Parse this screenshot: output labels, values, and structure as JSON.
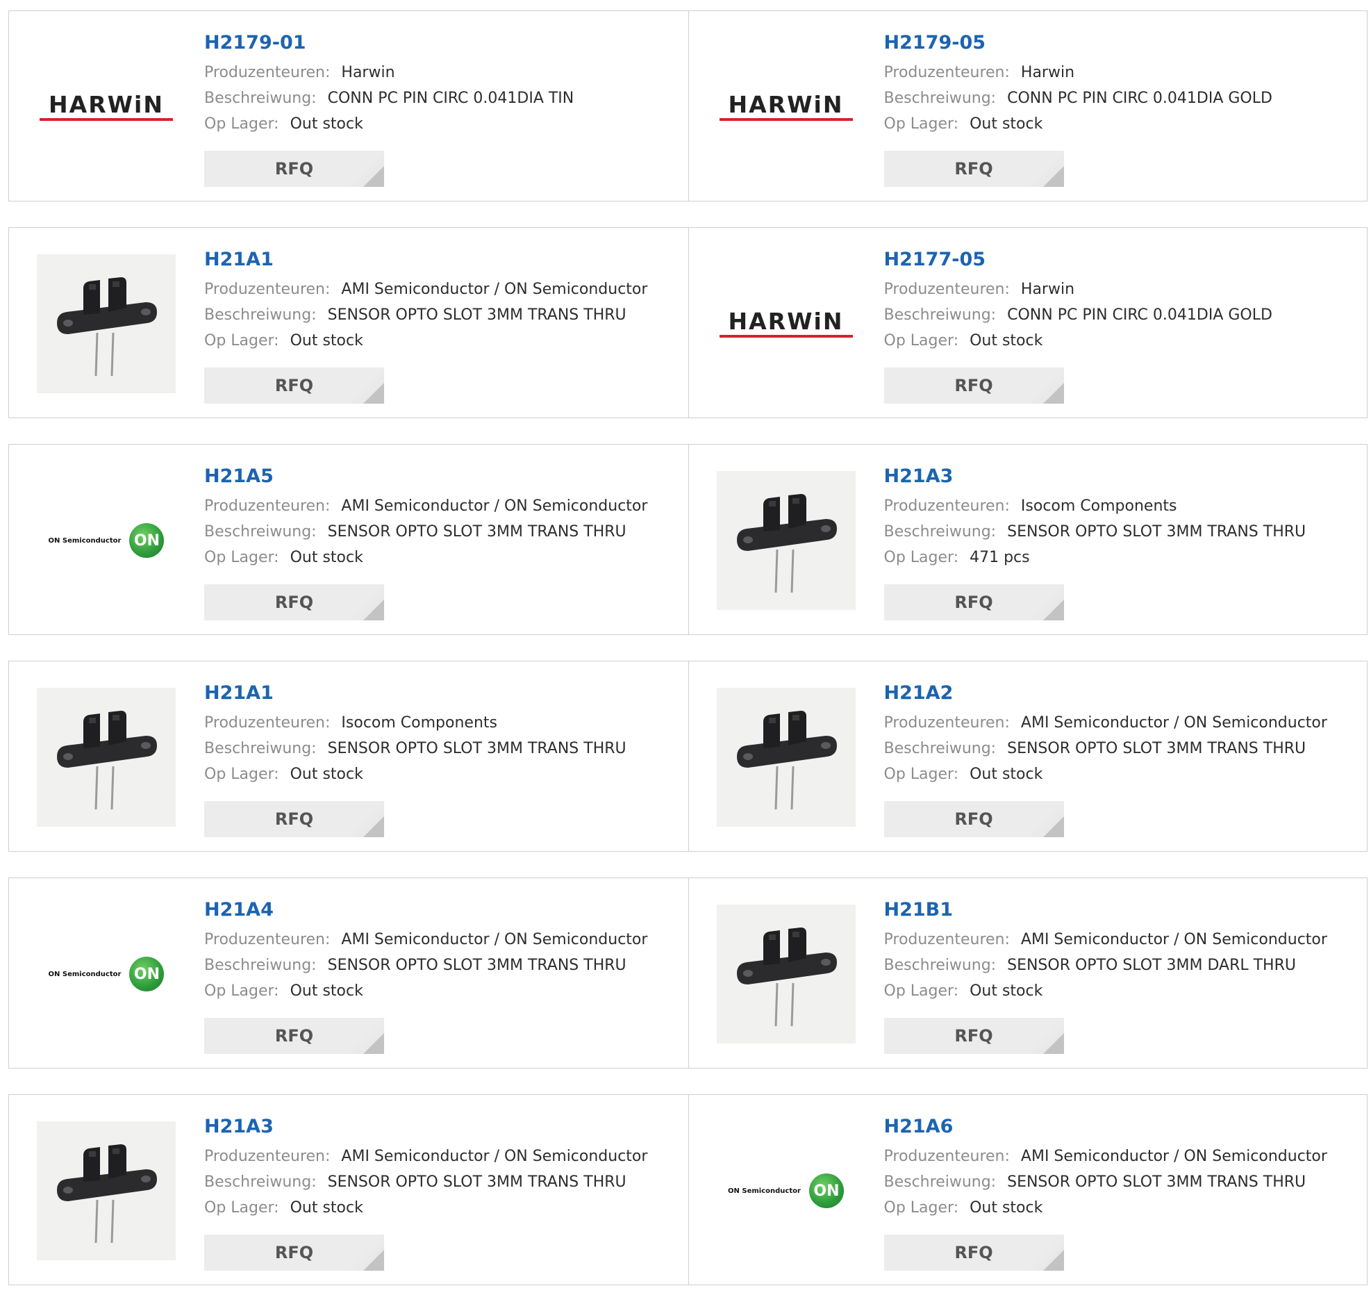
{
  "labels": {
    "manufacturer": "Produzenteuren:",
    "description": "Beschreiwung:",
    "stock": "Op Lager:",
    "rfq": "RFQ"
  },
  "brand_text": {
    "harwin": "HARWiN",
    "on_semi": "ON Semiconductor",
    "on_mark": "ON"
  },
  "colors": {
    "part_link": "#1c64b2",
    "label_gray": "#8c8c8c",
    "harwin_red": "#d8222a",
    "on_green": "#2c9b3a"
  },
  "products": [
    {
      "part": "H2179-01",
      "manufacturer": "Harwin",
      "description": "CONN PC PIN CIRC 0.041DIA TIN",
      "stock": "Out stock",
      "image": "harwin-logo"
    },
    {
      "part": "H2179-05",
      "manufacturer": "Harwin",
      "description": "CONN PC PIN CIRC 0.041DIA GOLD",
      "stock": "Out stock",
      "image": "harwin-logo"
    },
    {
      "part": "H21A1",
      "manufacturer": "AMI Semiconductor / ON Semiconductor",
      "description": "SENSOR OPTO SLOT 3MM TRANS THRU",
      "stock": "Out stock",
      "image": "opto-sensor-photo"
    },
    {
      "part": "H2177-05",
      "manufacturer": "Harwin",
      "description": "CONN PC PIN CIRC 0.041DIA GOLD",
      "stock": "Out stock",
      "image": "harwin-logo"
    },
    {
      "part": "H21A5",
      "manufacturer": "AMI Semiconductor / ON Semiconductor",
      "description": "SENSOR OPTO SLOT 3MM TRANS THRU",
      "stock": "Out stock",
      "image": "on-semi-logo"
    },
    {
      "part": "H21A3",
      "manufacturer": "Isocom Components",
      "description": "SENSOR OPTO SLOT 3MM TRANS THRU",
      "stock": "471 pcs",
      "image": "opto-sensor-photo"
    },
    {
      "part": "H21A1",
      "manufacturer": "Isocom Components",
      "description": "SENSOR OPTO SLOT 3MM TRANS THRU",
      "stock": "Out stock",
      "image": "opto-sensor-photo"
    },
    {
      "part": "H21A2",
      "manufacturer": "AMI Semiconductor / ON Semiconductor",
      "description": "SENSOR OPTO SLOT 3MM TRANS THRU",
      "stock": "Out stock",
      "image": "opto-sensor-photo"
    },
    {
      "part": "H21A4",
      "manufacturer": "AMI Semiconductor / ON Semiconductor",
      "description": "SENSOR OPTO SLOT 3MM TRANS THRU",
      "stock": "Out stock",
      "image": "on-semi-logo"
    },
    {
      "part": "H21B1",
      "manufacturer": "AMI Semiconductor / ON Semiconductor",
      "description": "SENSOR OPTO SLOT 3MM DARL THRU",
      "stock": "Out stock",
      "image": "opto-sensor-photo"
    },
    {
      "part": "H21A3",
      "manufacturer": "AMI Semiconductor / ON Semiconductor",
      "description": "SENSOR OPTO SLOT 3MM TRANS THRU",
      "stock": "Out stock",
      "image": "opto-sensor-photo"
    },
    {
      "part": "H21A6",
      "manufacturer": "AMI Semiconductor / ON Semiconductor",
      "description": "SENSOR OPTO SLOT 3MM TRANS THRU",
      "stock": "Out stock",
      "image": "on-semi-logo"
    }
  ]
}
